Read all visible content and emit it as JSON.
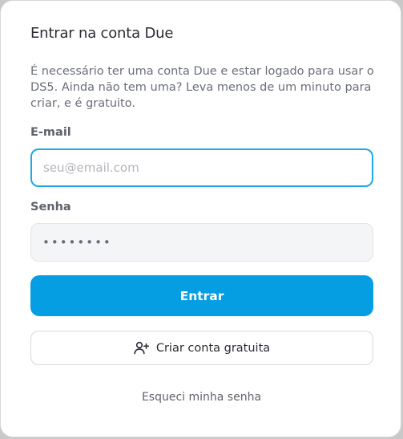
{
  "dialog": {
    "title": "Entrar na conta Due",
    "description": "É necessário ter uma conta Due e estar logado para usar o DS5. Ainda não tem uma? Leva menos de um minuto para criar, e é gratuito."
  },
  "form": {
    "email_label": "E-mail",
    "email_placeholder": "seu@email.com",
    "email_value": "",
    "password_label": "Senha",
    "password_value": "12345678"
  },
  "actions": {
    "login_label": "Entrar",
    "create_account_label": "Criar conta gratuita",
    "create_account_icon": "user-plus-icon",
    "forgot_password_label": "Esqueci minha senha"
  },
  "colors": {
    "primary": "#069ee3",
    "focus_border": "#1fa8e3",
    "text": "#2a2d34",
    "muted": "#6a6e78"
  }
}
